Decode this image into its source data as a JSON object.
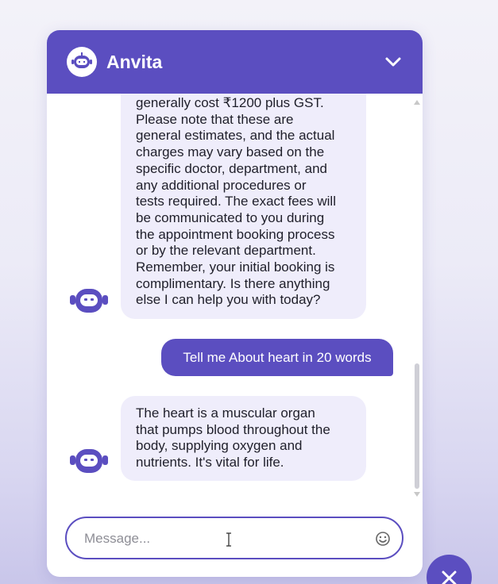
{
  "header": {
    "title": "Anvita",
    "avatar_icon": "robot-icon",
    "collapse_icon": "chevron-down-icon"
  },
  "messages": [
    {
      "sender": "bot",
      "text": "generally cost ₹1200 plus GST.\nPlease note that these are\ngeneral estimates, and the actual\ncharges may vary based on the\nspecific doctor, department, and\nany additional procedures or\ntests required. The exact fees will\nbe communicated to you during\nthe appointment booking process\nor by the relevant department.\nRemember, your initial booking is\ncomplimentary. Is there anything\nelse I can help you with today?"
    },
    {
      "sender": "user",
      "text": "Tell me About heart in 20 words"
    },
    {
      "sender": "bot",
      "text": "The heart is a muscular organ\nthat pumps blood throughout the\nbody, supplying oxygen and\nnutrients. It's vital for life."
    }
  ],
  "composer": {
    "placeholder": "Message...",
    "value": "",
    "emoji_icon": "smiley-icon"
  },
  "close_button": {
    "icon": "close-icon"
  },
  "colors": {
    "brand": "#5b4ec0",
    "bot_bubble": "#efedfb",
    "user_bubble_text": "#ffffff"
  }
}
